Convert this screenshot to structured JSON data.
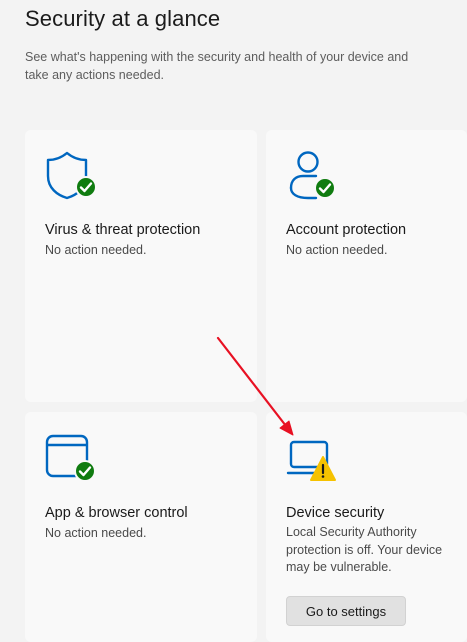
{
  "header": {
    "title": "Security at a glance",
    "description": "See what's happening with the security and health of your device and take any actions needed."
  },
  "cards": [
    {
      "icon": "shield-icon",
      "badge": "check-badge-icon",
      "title": "Virus & threat protection",
      "status": "No action needed."
    },
    {
      "icon": "person-icon",
      "badge": "check-badge-icon",
      "title": "Account protection",
      "status": "No action needed."
    },
    {
      "icon": "browser-window-icon",
      "badge": "check-badge-icon",
      "title": "App & browser control",
      "status": "No action needed."
    },
    {
      "icon": "laptop-icon",
      "badge": "warning-badge-icon",
      "title": "Device security",
      "status": "Local Security Authority protection is off. Your device may be vulnerable.",
      "button_label": "Go to settings"
    }
  ],
  "colors": {
    "icon_blue": "#0067c0",
    "ok_green": "#107c10",
    "warning_yellow": "#f6c200",
    "annotation_red": "#e81123"
  }
}
